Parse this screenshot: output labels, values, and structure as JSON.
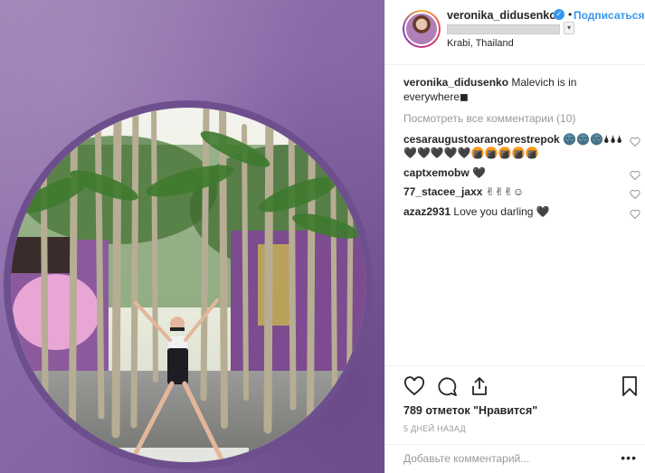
{
  "header": {
    "username": "veronika_didusenko",
    "follow_separator": "•",
    "follow_label": "Подписаться",
    "location": "Krabi, Thailand"
  },
  "caption": {
    "username": "veronika_didusenko",
    "text": "Malevich is in everywhere◼"
  },
  "view_all_comments": "Посмотреть все комментарии (10)",
  "comments": [
    {
      "username": "cesaraugustoarangorestrepok",
      "text": "🌚🌚🌚🌢🌢🌢🖤🖤🖤🖤🖤🍘🍘🍘🍘🍘"
    },
    {
      "username": "captxemobw",
      "text": "🖤"
    },
    {
      "username": "77_stacee_jaxx",
      "text": "✌✌✌☺"
    },
    {
      "username": "azaz2931",
      "text": "Love you darling 🖤"
    }
  ],
  "likes_text": "789 отметок \"Нравится\"",
  "posted_text": "5 ДНЕЙ НАЗАД",
  "add_comment_placeholder": "Добавьте комментарий...",
  "more_label": "•••",
  "icons": [
    "heart-icon",
    "comment-icon",
    "share-icon",
    "bookmark-icon",
    "verified-badge-icon"
  ],
  "colors": {
    "accent": "#3897f0",
    "wall": "#8a6aa8",
    "muted_text": "#999999"
  }
}
